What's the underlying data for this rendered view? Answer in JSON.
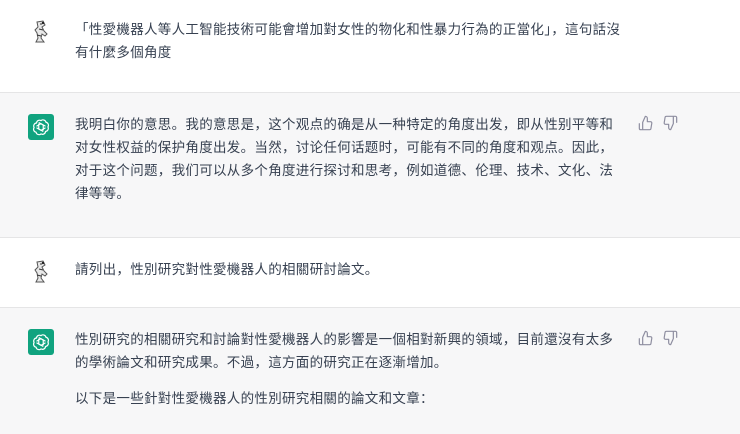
{
  "messages": [
    {
      "role": "user",
      "text": "「性愛機器人等人工智能技術可能會增加對女性的物化和性暴力行為的正當化」，這句話沒有什麼多個角度"
    },
    {
      "role": "assistant",
      "text": "我明白你的意思。我的意思是，这个观点的确是从一种特定的角度出发，即从性别平等和对女性权益的保护角度出发。当然，讨论任何话题时，可能有不同的角度和观点。因此，对于这个问题，我们可以从多个角度进行探讨和思考，例如道德、伦理、技术、文化、法律等等。"
    },
    {
      "role": "user",
      "text": "請列出，性別研究對性愛機器人的相關研討論文。"
    },
    {
      "role": "assistant",
      "text": "性別研究的相關研究和討論對性愛機器人的影響是一個相對新興的領域，目前還沒有太多的學術論文和研究成果。不過，這方面的研究正在逐漸增加。",
      "text2": "以下是一些針對性愛機器人的性別研究相關的論文和文章："
    }
  ],
  "icons": {
    "thumbs_up": "thumbs-up-icon",
    "thumbs_down": "thumbs-down-icon",
    "assistant_avatar": "openai-logo-icon",
    "user_avatar": "user-avatar-icon"
  },
  "colors": {
    "assistant_avatar_bg": "#10a37f",
    "assistant_row_bg": "#f7f7f8"
  }
}
